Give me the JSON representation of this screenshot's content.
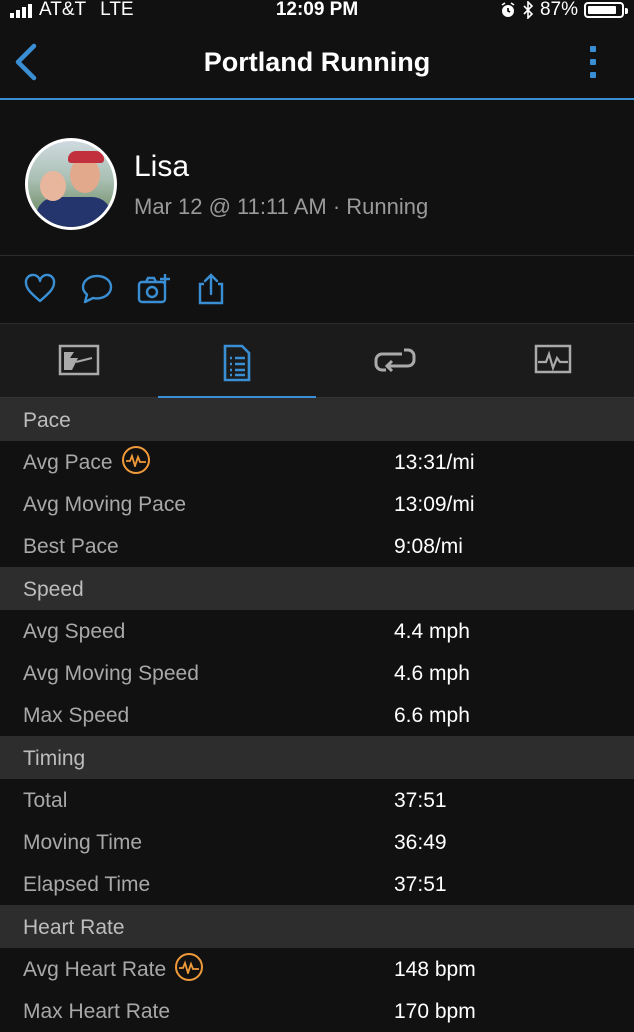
{
  "status": {
    "carrier": "AT&T",
    "network": "LTE",
    "time": "12:09 PM",
    "battery": "87%",
    "battery_level": 0.87
  },
  "nav": {
    "title": "Portland Running",
    "back_icon": "chevron-left-icon",
    "more_icon": "vertical-dots-icon"
  },
  "profile": {
    "name": "Lisa",
    "meta": "Mar 12 @ 11:11 AM · Running"
  },
  "actions": [
    "heart-icon",
    "comment-icon",
    "add-photo-icon",
    "share-icon"
  ],
  "tabs": [
    {
      "icon": "map-icon",
      "active": false
    },
    {
      "icon": "document-icon",
      "active": true
    },
    {
      "icon": "laps-icon",
      "active": false
    },
    {
      "icon": "chart-icon",
      "active": false
    }
  ],
  "colors": {
    "accent": "#3a8fd4",
    "hr_badge": "#ef9a3a",
    "background": "#111111",
    "section_bg": "#2d2d2d"
  },
  "sections": [
    {
      "title": "Pace",
      "rows": [
        {
          "label": "Avg Pace",
          "value": "13:31/mi",
          "badge": "heart-rate-icon"
        },
        {
          "label": "Avg Moving Pace",
          "value": "13:09/mi"
        },
        {
          "label": "Best Pace",
          "value": "9:08/mi"
        }
      ]
    },
    {
      "title": "Speed",
      "rows": [
        {
          "label": "Avg Speed",
          "value": "4.4 mph"
        },
        {
          "label": "Avg Moving Speed",
          "value": "4.6 mph"
        },
        {
          "label": "Max Speed",
          "value": "6.6 mph"
        }
      ]
    },
    {
      "title": "Timing",
      "rows": [
        {
          "label": "Total",
          "value": "37:51"
        },
        {
          "label": "Moving Time",
          "value": "36:49"
        },
        {
          "label": "Elapsed Time",
          "value": "37:51"
        }
      ]
    },
    {
      "title": "Heart Rate",
      "rows": [
        {
          "label": "Avg Heart Rate",
          "value": "148 bpm",
          "badge": "heart-rate-icon"
        },
        {
          "label": "Max Heart Rate",
          "value": "170 bpm"
        }
      ]
    }
  ]
}
